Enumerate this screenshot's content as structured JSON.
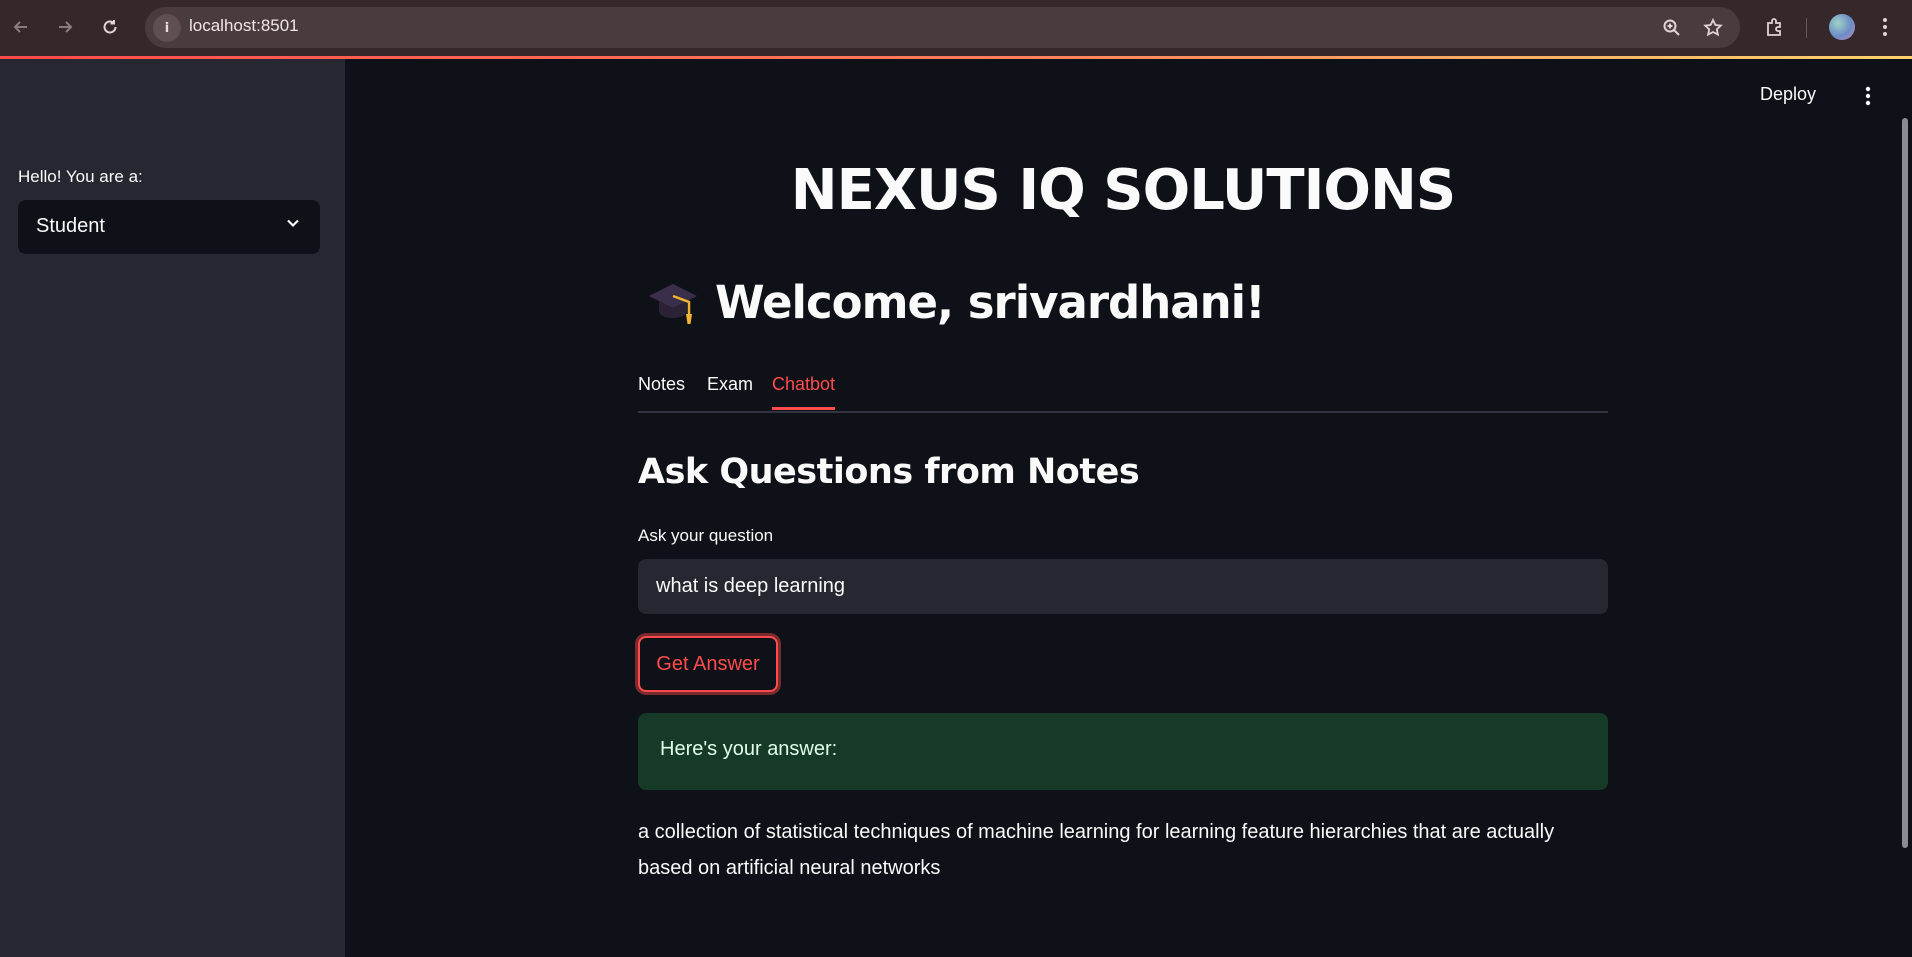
{
  "browser": {
    "url": "localhost:8501",
    "site_info_icon": "info-icon",
    "back_icon": "back-arrow-icon",
    "forward_icon": "forward-arrow-icon",
    "reload_icon": "reload-icon"
  },
  "header": {
    "deploy_label": "Deploy",
    "menu_icon": "more-vert-icon"
  },
  "sidebar": {
    "role_label": "Hello! You are a:",
    "role_selected": "Student"
  },
  "main": {
    "app_title": "NEXUS IQ SOLUTIONS",
    "welcome_emoji": "graduation-cap-icon",
    "welcome_text": "Welcome, srivardhani!",
    "tabs": [
      {
        "label": "Notes",
        "active": false
      },
      {
        "label": "Exam",
        "active": false
      },
      {
        "label": "Chatbot",
        "active": true
      }
    ],
    "section_heading": "Ask Questions from Notes",
    "question_label": "Ask your question",
    "question_value": "what is deep learning",
    "get_answer_label": "Get Answer",
    "success_message": "Here's your answer:",
    "answer": "a collection of statistical techniques of machine learning for learning feature hierarchies that are actually based on artificial neural networks"
  },
  "colors": {
    "accent": "#ff4b4b",
    "background": "#0e1117",
    "sidebar": "#262730",
    "success_bg": "#173928"
  }
}
